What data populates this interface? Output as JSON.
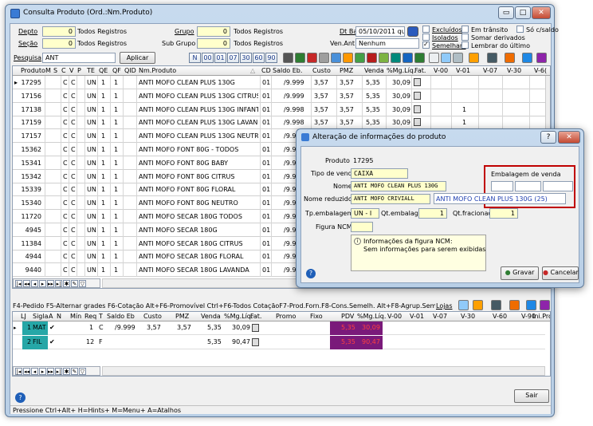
{
  "window": {
    "title": "Consulta Produto (Ord.:Nm.Produto)",
    "btn_min": "▭",
    "btn_max": "□",
    "btn_close": "✕"
  },
  "filters": {
    "depto_label": "Depto",
    "depto_value": "0",
    "depto_all": "Todos Registros",
    "secao_label": "Seção",
    "secao_value": "0",
    "secao_all": "Todos Registros",
    "grupo_label": "Grupo",
    "grupo_value": "0",
    "grupo_all": "Todos Registros",
    "subgrupo_label": "Sub Grupo",
    "subgrupo_value": "0",
    "subgrupo_all": "Todos Registros",
    "dtbase_label": "Dt Base",
    "dtbase_value": "05/10/2011 qua",
    "venant_label": "Ven.Ant",
    "venant_value": "Nenhum",
    "pesquisa_label": "Pesquisa",
    "pesquisa_value": "ANT",
    "aplicar_label": "Aplicar",
    "code_buttons": [
      "N",
      "00",
      "01",
      "07",
      "30",
      "60",
      "90"
    ],
    "checks": [
      {
        "label": "Excluídos",
        "checked": false
      },
      {
        "label": "Isolados",
        "checked": false
      },
      {
        "label": "Semelhan.",
        "checked": true
      },
      {
        "label": "Em trânsito",
        "checked": false
      },
      {
        "label": "Somar derivados",
        "checked": false
      },
      {
        "label": "Lembrar do último",
        "checked": false
      },
      {
        "label": "Só c/saldo",
        "checked": false
      }
    ]
  },
  "main_grid": {
    "headers": [
      "Produto",
      "M",
      "S",
      "C",
      "V",
      "P",
      "TE",
      "QE",
      "QF",
      "QID",
      "Nm.Produto",
      "CD",
      "Saldo Eb.",
      "Custo",
      "PMZ",
      "Venda",
      "%Mg.Líq.",
      "Fat.",
      "V-00",
      "V-01",
      "V-07",
      "V-30",
      "V-6("
    ],
    "rows": [
      {
        "produto": "17295",
        "c": "C",
        "v": "C",
        "te": "UN",
        "qe": "1",
        "qf": "1",
        "nome": "ANTI MOFO CLEAN PLUS 130G",
        "cd": "01",
        "saldo": "/9.999",
        "custo": "3,57",
        "pmz": "3,57",
        "venda": "5,35",
        "mg": "30,09",
        "v00": "",
        "v01": ""
      },
      {
        "produto": "17156",
        "c": "C",
        "v": "C",
        "te": "UN",
        "qe": "1",
        "qf": "1",
        "nome": "ANTI MOFO CLEAN PLUS 130G CITRUS",
        "cd": "01",
        "saldo": "/9.999",
        "custo": "3,57",
        "pmz": "3,57",
        "venda": "5,35",
        "mg": "30,09",
        "v00": "",
        "v01": ""
      },
      {
        "produto": "17138",
        "c": "C",
        "v": "C",
        "te": "UN",
        "qe": "1",
        "qf": "1",
        "nome": "ANTI MOFO CLEAN PLUS 130G INFANTIL",
        "cd": "01",
        "saldo": "/9.998",
        "custo": "3,57",
        "pmz": "3,57",
        "venda": "5,35",
        "mg": "30,09",
        "v00": "",
        "v01": "1"
      },
      {
        "produto": "17159",
        "c": "C",
        "v": "C",
        "te": "UN",
        "qe": "1",
        "qf": "1",
        "nome": "ANTI MOFO CLEAN PLUS 130G LAVANDA",
        "cd": "01",
        "saldo": "/9.998",
        "custo": "3,57",
        "pmz": "3,57",
        "venda": "5,35",
        "mg": "30,09",
        "v00": "",
        "v01": "1"
      },
      {
        "produto": "17157",
        "c": "C",
        "v": "C",
        "te": "UN",
        "qe": "1",
        "qf": "1",
        "nome": "ANTI MOFO CLEAN PLUS 130G NEUTRO",
        "cd": "01",
        "saldo": "/9.999",
        "custo": "3,57",
        "pmz": "3,57",
        "venda": "5,35",
        "mg": "30,09",
        "v00": "",
        "v01": ""
      },
      {
        "produto": "15362",
        "c": "C",
        "v": "C",
        "te": "UN",
        "qe": "1",
        "qf": "1",
        "nome": "ANTI MOFO FONT 80G - TODOS",
        "cd": "01",
        "saldo": "/9.999",
        "custo": "",
        "pmz": "",
        "venda": "",
        "mg": "",
        "v00": "",
        "v01": ""
      },
      {
        "produto": "15341",
        "c": "C",
        "v": "C",
        "te": "UN",
        "qe": "1",
        "qf": "1",
        "nome": "ANTI MOFO FONT 80G BABY",
        "cd": "01",
        "saldo": "/9.999",
        "custo": "",
        "pmz": "",
        "venda": "",
        "mg": "",
        "v00": "",
        "v01": ""
      },
      {
        "produto": "15342",
        "c": "C",
        "v": "C",
        "te": "UN",
        "qe": "1",
        "qf": "1",
        "nome": "ANTI MOFO FONT 80G CITRUS",
        "cd": "01",
        "saldo": "/9.999",
        "custo": "",
        "pmz": "",
        "venda": "",
        "mg": "",
        "v00": "",
        "v01": ""
      },
      {
        "produto": "15339",
        "c": "C",
        "v": "C",
        "te": "UN",
        "qe": "1",
        "qf": "1",
        "nome": "ANTI MOFO FONT 80G FLORAL",
        "cd": "01",
        "saldo": "/9.999",
        "custo": "",
        "pmz": "",
        "venda": "",
        "mg": "",
        "v00": "",
        "v01": ""
      },
      {
        "produto": "15340",
        "c": "C",
        "v": "C",
        "te": "UN",
        "qe": "1",
        "qf": "1",
        "nome": "ANTI MOFO FONT 80G NEUTRO",
        "cd": "01",
        "saldo": "/9.999",
        "custo": "",
        "pmz": "",
        "venda": "",
        "mg": "",
        "v00": "",
        "v01": ""
      },
      {
        "produto": "11720",
        "c": "C",
        "v": "C",
        "te": "UN",
        "qe": "1",
        "qf": "1",
        "nome": "ANTI MOFO SECAR 180G TODOS",
        "cd": "01",
        "saldo": "/9.999",
        "custo": "",
        "pmz": "",
        "venda": "",
        "mg": "",
        "v00": "",
        "v01": ""
      },
      {
        "produto": "4945",
        "c": "C",
        "v": "C",
        "te": "UN",
        "qe": "1",
        "qf": "1",
        "nome": "ANTI MOFO SECAR 180G",
        "cd": "01",
        "saldo": "/9.999",
        "custo": "",
        "pmz": "",
        "venda": "",
        "mg": "",
        "v00": "",
        "v01": ""
      },
      {
        "produto": "11384",
        "c": "C",
        "v": "C",
        "te": "UN",
        "qe": "1",
        "qf": "1",
        "nome": "ANTI MOFO SECAR 180G CITRUS",
        "cd": "01",
        "saldo": "/9.999",
        "custo": "",
        "pmz": "",
        "venda": "",
        "mg": "",
        "v00": "",
        "v01": ""
      },
      {
        "produto": "4944",
        "c": "C",
        "v": "C",
        "te": "UN",
        "qe": "1",
        "qf": "1",
        "nome": "ANTI MOFO SECAR 180G FLORAL",
        "cd": "01",
        "saldo": "/9.999",
        "custo": "",
        "pmz": "",
        "venda": "",
        "mg": "",
        "v00": "",
        "v01": ""
      },
      {
        "produto": "9440",
        "c": "C",
        "v": "C",
        "te": "UN",
        "qe": "1",
        "qf": "1",
        "nome": "ANTI MOFO SECAR 180G LAVANDA",
        "cd": "01",
        "saldo": "/9.999",
        "custo": "",
        "pmz": "",
        "venda": "",
        "mg": "",
        "v00": "",
        "v01": ""
      }
    ]
  },
  "shortcuts_bar": {
    "text": "F4-Pedido F5-Alternar grades F6-Cotação Alt+F6-Promovível Ctrl+F6-Todos CotaçãoF7-Prod.Forn.F8-Cons.Semelh. Alt+F8-Agrup.Semelh. F10-Alt.Dimen.",
    "lojas": "Lojas"
  },
  "lower_grid": {
    "headers": [
      "LJ",
      "Sigla",
      "A",
      "N",
      "Mín",
      "Req",
      "T",
      "Saldo Eb",
      "Custo",
      "PMZ",
      "Venda",
      "%Mg.Líq.",
      "Fat.",
      "Promo",
      "Fixo",
      "PDV",
      "%Mg.Líq.",
      "V-00",
      "V-01",
      "V-07",
      "V-30",
      "V-60",
      "V-90",
      "Ini.Pron"
    ],
    "rows": [
      {
        "lj": "1",
        "sigla": "MAT",
        "req": "1",
        "t": "C",
        "saldo": "/9.999",
        "custo": "3,57",
        "pmz": "3,57",
        "venda": "5,35",
        "mg": "30,09",
        "pdv": "5,35",
        "pdvmg": "30,09"
      },
      {
        "lj": "2",
        "sigla": "FIL",
        "req": "12",
        "t": "F",
        "saldo": "",
        "custo": "",
        "pmz": "",
        "venda": "5,35",
        "mg": "90,47",
        "pdv": "5,35",
        "pdvmg": "90,47"
      }
    ]
  },
  "sair_label": "Sair",
  "status_bar": "Pressione Ctrl+Alt+ H=Hints+ M=Menu+ A=Atalhos",
  "dialog": {
    "title": "Alteração de informações do produto",
    "produto_label": "Produto",
    "produto_value": "17295",
    "tipo_venda_label": "Tipo de venda",
    "tipo_venda_value": "CAIXA",
    "nome_label": "Nome",
    "nome_value": "ANTI MOFO CLEAN PLUS 130G",
    "nome_reduzido_label": "Nome reduzido",
    "nome_reduzido_value": "ANTI MOFO CRIVIALL",
    "embalagem_venda_label": "Embalagem de venda",
    "embalagem_suggestion": "ANTI MOFO CLEAN PLUS 130G (25)",
    "tp_embalagem_label": "Tp.embalagem",
    "tp_embalagem_value": "UN - I",
    "qt_embalagem_label": "Qt.embalagem",
    "qt_embalagem_value": "1",
    "qt_fracionado_label": "Qt.fracionado",
    "qt_fracionado_value": "1",
    "figura_ncm_label": "Figura NCM",
    "info_title": "Informações da figura NCM:",
    "info_text": "Sem informações para serem exibidas",
    "gravar_label": "Gravar",
    "cancelar_label": "Cancelar",
    "help_icon": "?",
    "highlight_color": "#c00000"
  }
}
